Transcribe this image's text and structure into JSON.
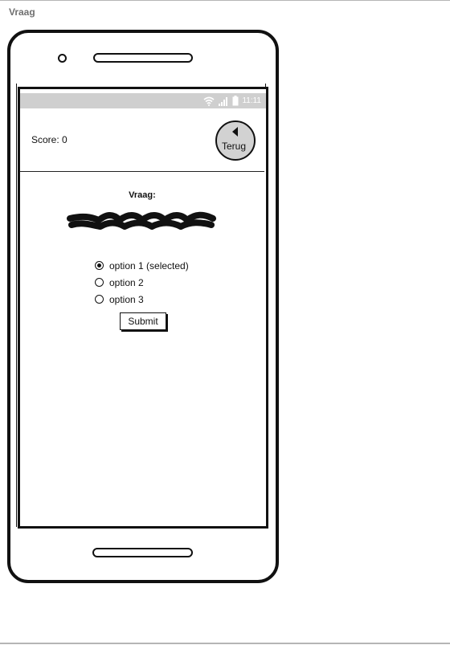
{
  "page": {
    "title": "Vraag"
  },
  "status_bar": {
    "time": "11:11",
    "icons": [
      "wifi-icon",
      "signal-icon",
      "battery-icon"
    ]
  },
  "header": {
    "score": "Score: 0",
    "back_label": "Terug",
    "back_icon": "back-arrow-icon"
  },
  "question": {
    "label": "Vraag:",
    "text_placeholder": "scribble-text"
  },
  "options": [
    {
      "label": "option 1 (selected)",
      "selected": true
    },
    {
      "label": "option 2",
      "selected": false
    },
    {
      "label": "option 3",
      "selected": false
    }
  ],
  "submit_label": "Submit",
  "colors": {
    "status_bar": "#cfcfcf",
    "button_gray": "#d2d2d2",
    "ink": "#111111"
  }
}
